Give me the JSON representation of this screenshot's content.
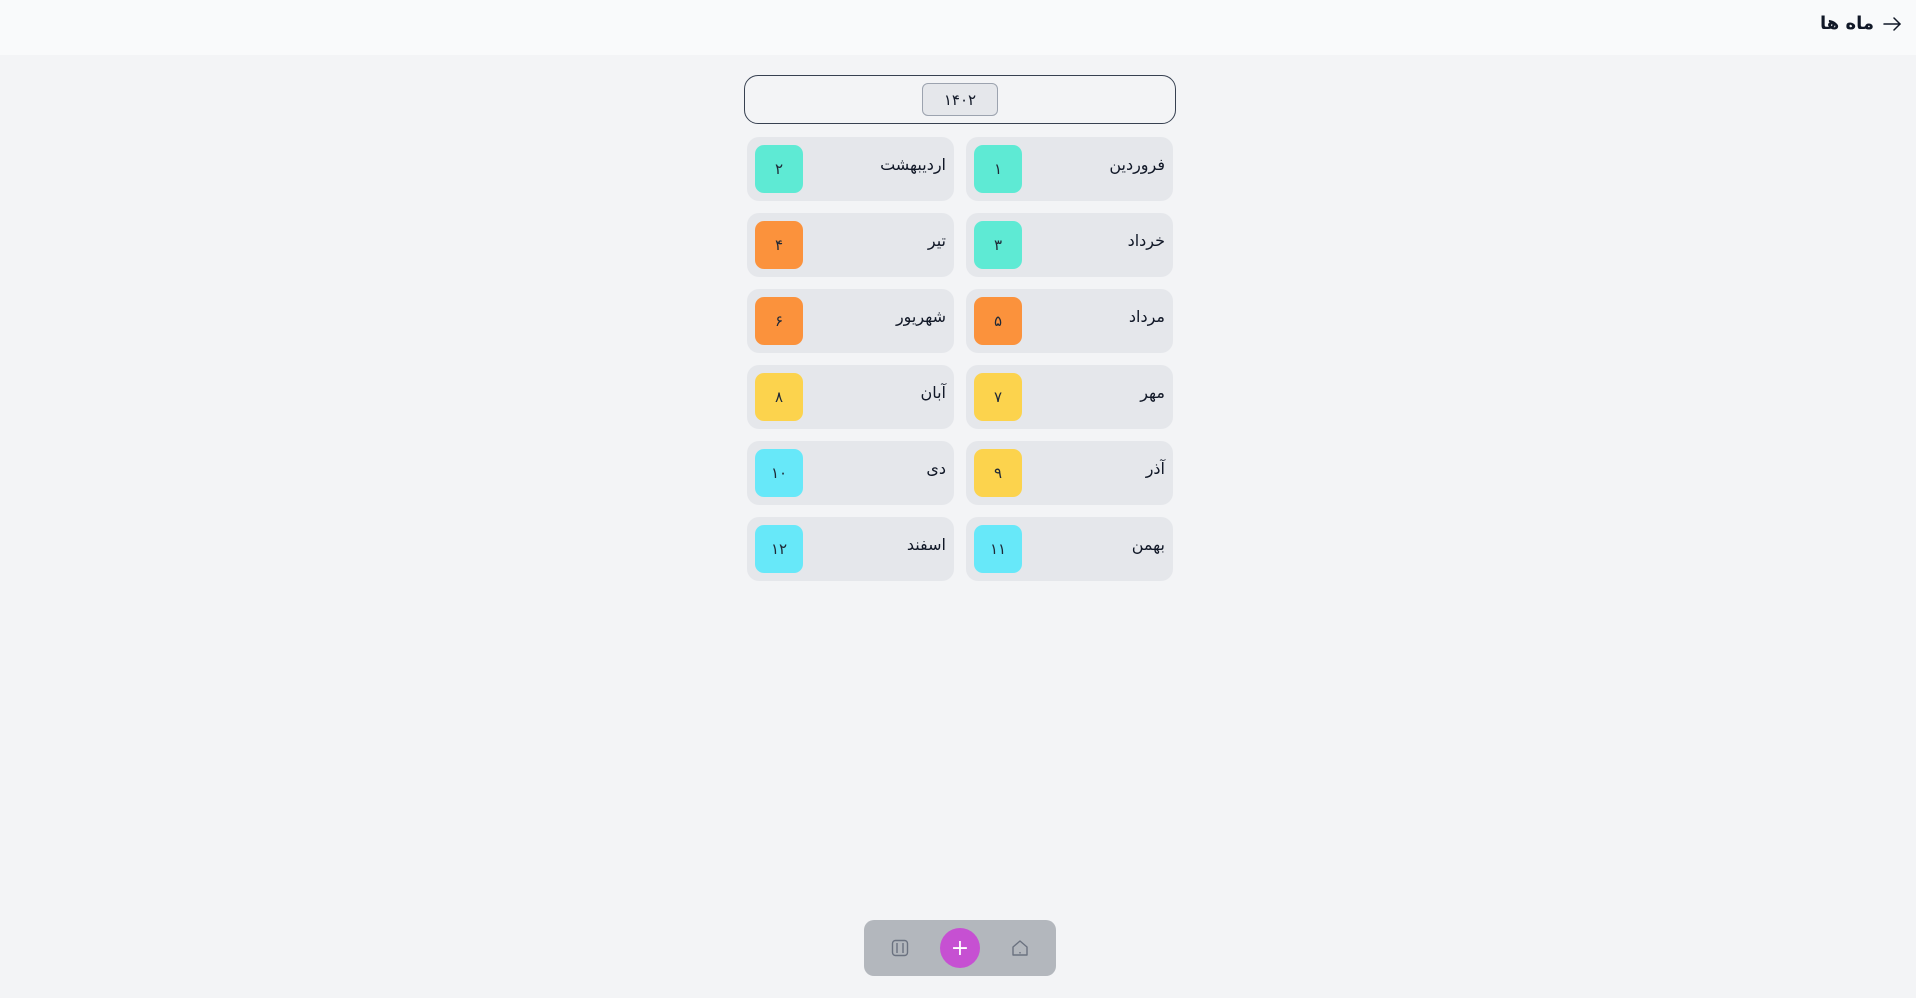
{
  "header": {
    "title": "ماه ها",
    "back_icon": "arrow-right-icon"
  },
  "year_selector": {
    "value": "۱۴۰۲"
  },
  "months": [
    {
      "name": "فروردین",
      "number": "۱",
      "color": "#5eead4"
    },
    {
      "name": "اردیبهشت",
      "number": "۲",
      "color": "#5eead4"
    },
    {
      "name": "خرداد",
      "number": "۳",
      "color": "#5eead4"
    },
    {
      "name": "تیر",
      "number": "۴",
      "color": "#fb923c"
    },
    {
      "name": "مرداد",
      "number": "۵",
      "color": "#fb923c"
    },
    {
      "name": "شهریور",
      "number": "۶",
      "color": "#fb923c"
    },
    {
      "name": "مهر",
      "number": "۷",
      "color": "#fcd34d"
    },
    {
      "name": "آبان",
      "number": "۸",
      "color": "#fcd34d"
    },
    {
      "name": "آذر",
      "number": "۹",
      "color": "#fcd34d"
    },
    {
      "name": "دی",
      "number": "۱۰",
      "color": "#67e8f9"
    },
    {
      "name": "بهمن",
      "number": "۱۱",
      "color": "#67e8f9"
    },
    {
      "name": "اسفند",
      "number": "۱۲",
      "color": "#67e8f9"
    }
  ],
  "bottom_bar": {
    "left_icon": "calendar-icon",
    "add_label": "+",
    "add_color": "#c650d2",
    "right_icon": "home-icon"
  }
}
